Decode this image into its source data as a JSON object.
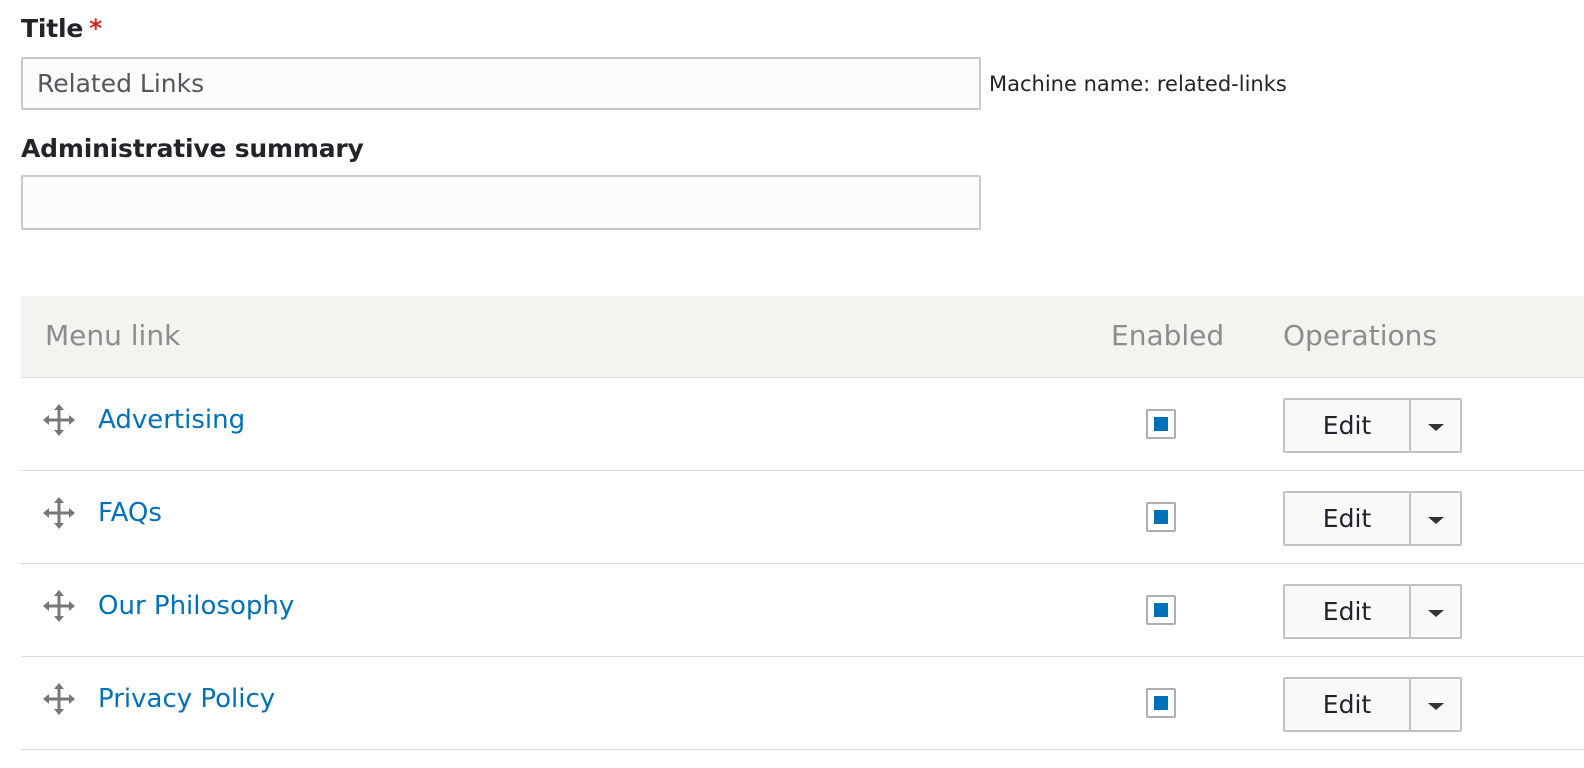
{
  "form": {
    "title_label": "Title",
    "required_marker": "*",
    "title_value": "Related Links",
    "machine_name_label": "Machine name: related-links",
    "summary_label": "Administrative summary",
    "summary_value": ""
  },
  "table": {
    "headers": {
      "menu_link": "Menu link",
      "enabled": "Enabled",
      "operations": "Operations"
    },
    "rows": [
      {
        "label": "Advertising",
        "enabled": true,
        "edit_label": "Edit",
        "drag_icon": "move-icon",
        "toggle_icon": "chevron-down-icon"
      },
      {
        "label": "FAQs",
        "enabled": true,
        "edit_label": "Edit",
        "drag_icon": "move-icon",
        "toggle_icon": "chevron-down-icon"
      },
      {
        "label": "Our Philosophy",
        "enabled": true,
        "edit_label": "Edit",
        "drag_icon": "move-icon",
        "toggle_icon": "chevron-down-icon"
      },
      {
        "label": "Privacy Policy",
        "enabled": true,
        "edit_label": "Edit",
        "drag_icon": "move-icon",
        "toggle_icon": "chevron-down-icon"
      }
    ]
  },
  "colors": {
    "link": "#0071b8",
    "required": "#dc2323",
    "header_bg": "#f3f3f0",
    "checkbox_fill": "#0071b8"
  }
}
